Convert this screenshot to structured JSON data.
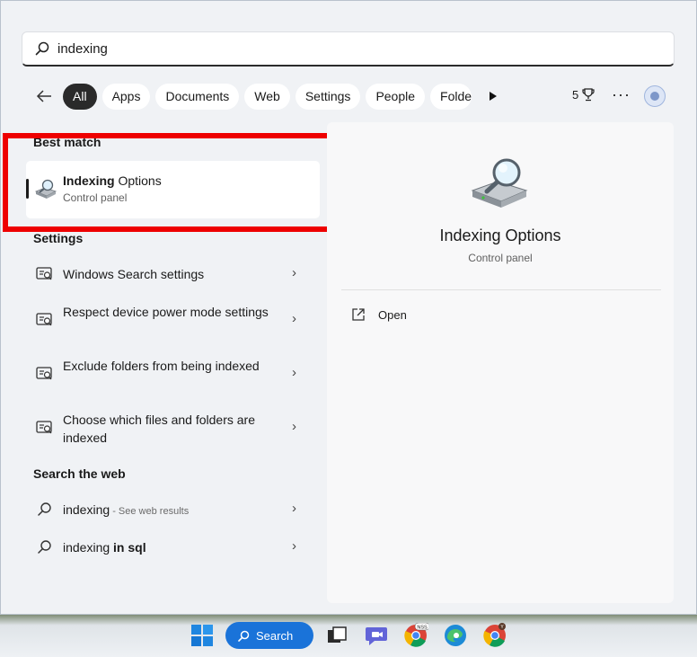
{
  "search": {
    "value": "indexing",
    "icon": "search-icon"
  },
  "filters": {
    "back_icon": "back-arrow-icon",
    "chips": [
      {
        "label": "All",
        "active": true
      },
      {
        "label": "Apps",
        "active": false
      },
      {
        "label": "Documents",
        "active": false
      },
      {
        "label": "Web",
        "active": false
      },
      {
        "label": "Settings",
        "active": false
      },
      {
        "label": "People",
        "active": false
      },
      {
        "label": "Folde",
        "active": false
      }
    ],
    "points": "5",
    "more_label": "···"
  },
  "best_match": {
    "section_label": "Best match",
    "title_bold": "Indexing",
    "title_rest": " Options",
    "subtitle": "Control panel"
  },
  "settings": {
    "section_label": "Settings",
    "items": [
      {
        "label": "Windows Search settings"
      },
      {
        "label": "Respect device power mode settings"
      },
      {
        "label": "Exclude folders from being indexed"
      },
      {
        "label": "Choose which files and folders are indexed"
      }
    ]
  },
  "web": {
    "section_label": "Search the web",
    "items": [
      {
        "query": "indexing",
        "suffix": " - See web results",
        "bold_suffix": ""
      },
      {
        "query": "indexing ",
        "suffix": "",
        "bold_suffix": "in sql"
      }
    ]
  },
  "preview": {
    "title": "Indexing Options",
    "subtitle": "Control panel",
    "open_label": "Open"
  },
  "taskbar": {
    "search_label": "Search",
    "chrome_badge": "NSS",
    "chrome2_badge": "Y"
  },
  "colors": {
    "highlight": "#ee0000",
    "accent_blue": "#1a73d9",
    "active_chip": "#2a2a2a"
  }
}
